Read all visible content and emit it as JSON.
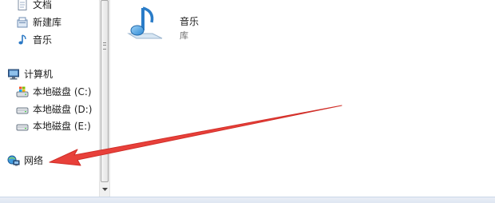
{
  "nav": {
    "items": [
      {
        "label": "文档",
        "icon": "documents-icon"
      },
      {
        "label": "新建库",
        "icon": "new-library-icon"
      },
      {
        "label": "音乐",
        "icon": "music-icon"
      },
      {
        "label": "计算机",
        "icon": "computer-icon"
      },
      {
        "label": "本地磁盘 (C:)",
        "icon": "system-drive-icon"
      },
      {
        "label": "本地磁盘 (D:)",
        "icon": "hard-drive-icon"
      },
      {
        "label": "本地磁盘 (E:)",
        "icon": "hard-drive-icon"
      },
      {
        "label": "网络",
        "icon": "network-icon"
      }
    ]
  },
  "content": {
    "item": {
      "name": "音乐",
      "type": "库",
      "icon": "music-library-icon"
    }
  },
  "annotation": {
    "color": "#e8403a",
    "icon": "red-arrow-pointer"
  }
}
